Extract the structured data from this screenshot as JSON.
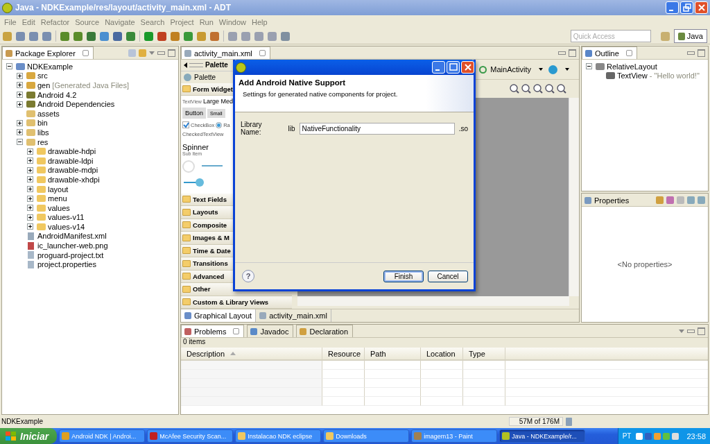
{
  "window": {
    "title": "Java - NDKExample/res/layout/activity_main.xml - ADT"
  },
  "menu": [
    "File",
    "Edit",
    "Refactor",
    "Source",
    "Navigate",
    "Search",
    "Project",
    "Run",
    "Window",
    "Help"
  ],
  "quick_access": {
    "placeholder": "Quick Access"
  },
  "perspective": {
    "label": "Java",
    "selected": true
  },
  "package_explorer": {
    "title": "Package Explorer",
    "tree": [
      {
        "label": "NDKExample",
        "kind": "project",
        "expanded": true,
        "children": [
          {
            "label": "src",
            "kind": "source-folder",
            "expanded": false
          },
          {
            "label": "gen",
            "detail": "[Generated Java Files]",
            "kind": "source-folder",
            "expanded": false
          },
          {
            "label": "Android 4.2",
            "kind": "library",
            "expanded": false
          },
          {
            "label": "Android Dependencies",
            "kind": "library",
            "expanded": false
          },
          {
            "label": "assets",
            "kind": "package-folder"
          },
          {
            "label": "bin",
            "kind": "package-folder",
            "expanded": false
          },
          {
            "label": "libs",
            "kind": "package-folder",
            "expanded": false
          },
          {
            "label": "res",
            "kind": "package-folder",
            "expanded": true,
            "children": [
              {
                "label": "drawable-hdpi",
                "kind": "folder",
                "expanded": false
              },
              {
                "label": "drawable-ldpi",
                "kind": "folder",
                "expanded": false
              },
              {
                "label": "drawable-mdpi",
                "kind": "folder",
                "expanded": false
              },
              {
                "label": "drawable-xhdpi",
                "kind": "folder",
                "expanded": false
              },
              {
                "label": "layout",
                "kind": "folder",
                "expanded": false
              },
              {
                "label": "menu",
                "kind": "folder",
                "expanded": false
              },
              {
                "label": "values",
                "kind": "folder",
                "expanded": false
              },
              {
                "label": "values-v11",
                "kind": "folder",
                "expanded": false
              },
              {
                "label": "values-v14",
                "kind": "folder",
                "expanded": false
              }
            ]
          },
          {
            "label": "AndroidManifest.xml",
            "kind": "xml-file"
          },
          {
            "label": "ic_launcher-web.png",
            "kind": "image-file"
          },
          {
            "label": "proguard-project.txt",
            "kind": "text-file"
          },
          {
            "label": "project.properties",
            "kind": "text-file"
          }
        ]
      }
    ]
  },
  "editor": {
    "tab": "activity_main.xml",
    "palette": {
      "title": "Palette",
      "menu_label": "Palette",
      "form_widgets": {
        "label": "Form Widget",
        "textview_label": "TextView",
        "large_text": "Large Medi",
        "buttons": [
          "Button",
          "Small"
        ],
        "checkbox": {
          "label": "CheckBox",
          "checked": true
        },
        "radio": {
          "label": "Ra",
          "checked": true
        },
        "checked_text_view": "CheckedTextView",
        "spinner": {
          "label": "Spinner",
          "sub": "Sub Item"
        }
      },
      "categories": [
        "Text Fields",
        "Layouts",
        "Composite",
        "Images & M",
        "Time & Date",
        "Transitions",
        "Advanced",
        "Other",
        "Custom & Library Views"
      ]
    },
    "activity": "MainActivity",
    "bottom_tabs": [
      {
        "label": "Graphical Layout",
        "selected": true
      },
      {
        "label": "activity_main.xml",
        "selected": false
      }
    ]
  },
  "outline": {
    "title": "Outline",
    "tree": [
      {
        "label": "RelativeLayout",
        "kind": "layout",
        "expanded": true,
        "children": [
          {
            "label": "TextView",
            "detail": "- \"Hello world!\"",
            "kind": "text-view"
          }
        ]
      }
    ]
  },
  "properties": {
    "title": "Properties",
    "empty": "<No properties>"
  },
  "problems": {
    "tabs": [
      {
        "label": "Problems",
        "selected": true
      },
      {
        "label": "Javadoc",
        "selected": false
      },
      {
        "label": "Declaration",
        "selected": false
      }
    ],
    "count": "0 items",
    "columns": [
      "Description",
      "Resource",
      "Path",
      "Location",
      "Type"
    ]
  },
  "status_bar": {
    "text": "NDKExample",
    "heap": "57M of 176M"
  },
  "taskbar": {
    "start": "Iniciar",
    "tasks": [
      {
        "label": "Android NDK | Androi...",
        "selected": false
      },
      {
        "label": "McAfee Security Scan...",
        "selected": false
      },
      {
        "label": "Instalacao NDK eclipse",
        "selected": false
      },
      {
        "label": "Downloads",
        "selected": false
      },
      {
        "label": "imagem13 - Paint",
        "selected": false
      },
      {
        "label": "Java - NDKExample/r...",
        "selected": true
      }
    ],
    "language": "PT",
    "clock": "23:58"
  },
  "dialog": {
    "heading": "Add Android Native Support",
    "description": "Settings for generated native components for project.",
    "field_label": "Library Name:",
    "prefix": "lib",
    "value": "NativeFunctionality",
    "suffix": ".so",
    "help": "?",
    "buttons": [
      {
        "label": "Finish",
        "default": true
      },
      {
        "label": "Cancel",
        "default": false
      }
    ]
  }
}
